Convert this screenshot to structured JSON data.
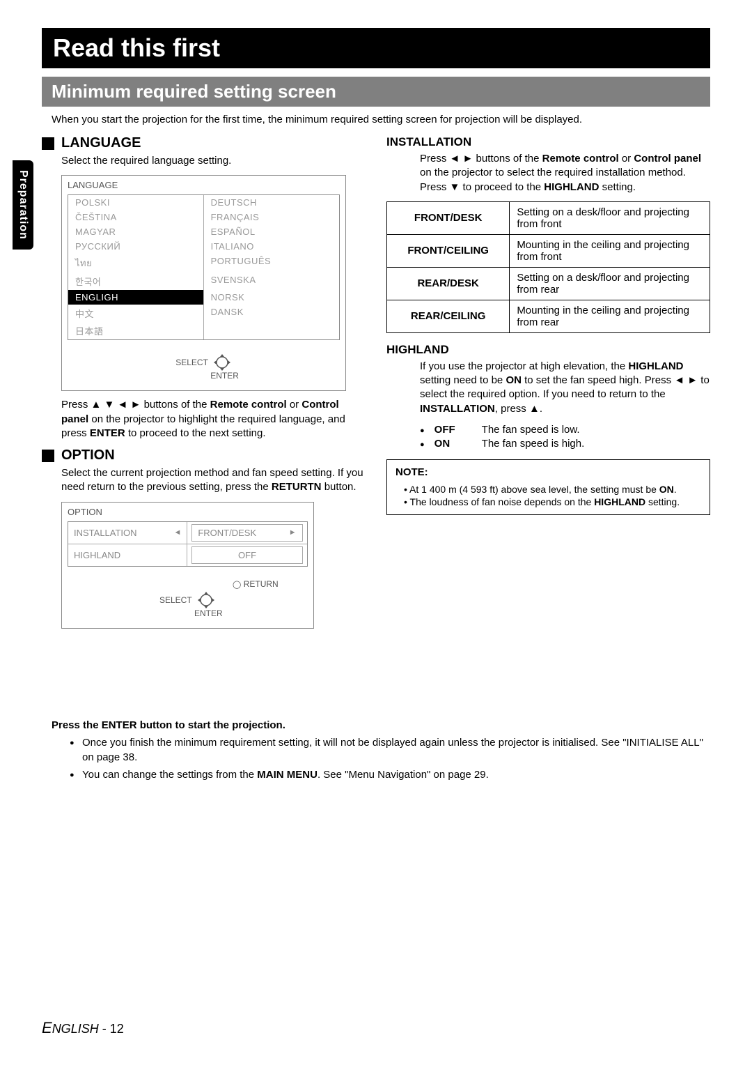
{
  "side_tab": "Preparation",
  "title": "Read this first",
  "section": "Minimum required setting screen",
  "intro": "When you start the projection for the first time, the minimum required setting screen for projection will be displayed.",
  "language": {
    "heading": "LANGUAGE",
    "desc": "Select the required language setting.",
    "menu_title": "LANGUAGE",
    "items_left": [
      "POLSKI",
      "ČEŠTINA",
      "MAGYAR",
      "РУССКИЙ",
      "ไทย",
      "한국어",
      "ENGLIGH",
      "中文",
      "日本語"
    ],
    "items_right": [
      "DEUTSCH",
      "FRANÇAIS",
      "ESPAÑOL",
      "ITALIANO",
      "PORTUGUÊS",
      "SVENSKA",
      "NORSK",
      "DANSK",
      ""
    ],
    "selected": "ENGLIGH",
    "select_label": "SELECT",
    "enter_label": "ENTER",
    "instruction_pre": "Press ",
    "instruction_mid": " buttons of the ",
    "remote": "Remote control",
    "or": " or ",
    "control_panel": "Control panel",
    "instruction_post1": " on the projector to highlight the required language, and press ",
    "enter_bold": "ENTER",
    "instruction_post2": " to proceed to the next setting."
  },
  "option": {
    "heading": "OPTION",
    "desc_pre": "Select the current projection method and fan speed setting. If you need return to the previous setting, press the ",
    "return_bold": "RETURTN",
    "desc_post": " button.",
    "menu_title": "OPTION",
    "rows": [
      {
        "label": "INSTALLATION",
        "value": "FRONT/DESK",
        "arrows": true
      },
      {
        "label": "HIGHLAND",
        "value": "OFF",
        "arrows": false
      }
    ],
    "return_label": "RETURN",
    "select_label": "SELECT",
    "enter_label": "ENTER"
  },
  "installation": {
    "heading": "INSTALLATION",
    "desc_pre": "Press ",
    "desc_mid1": " buttons of the ",
    "remote": "Remote control",
    "or": " or ",
    "control_panel": "Control panel",
    "desc_mid2": " on the projector to select the required installation method. Press ",
    "desc_post": " to proceed to the ",
    "highland_bold": "HIGHLAND",
    "setting_word": " setting.",
    "table": [
      {
        "mode": "FRONT/DESK",
        "desc": "Setting on a desk/floor and projecting from front"
      },
      {
        "mode": "FRONT/CEILING",
        "desc": "Mounting in the ceiling and projecting from front"
      },
      {
        "mode": "REAR/DESK",
        "desc": "Setting on a desk/floor and projecting from rear"
      },
      {
        "mode": "REAR/CEILING",
        "desc": "Mounting in the ceiling and projecting from rear"
      }
    ]
  },
  "highland": {
    "heading": "HIGHLAND",
    "p1a": "If you use the projector at high elevation, the ",
    "p1b": "HIGHLAND",
    "p1c": " setting need to be ",
    "p1d": "ON",
    "p1e": " to set the fan speed high. Press ",
    "p1f": " to select the required option. If you need to return to the ",
    "p1g": "INSTALLATION",
    "p1h": ", press ",
    "p1i": ".",
    "off_label": "OFF",
    "off_desc": "The fan speed is low.",
    "on_label": "ON",
    "on_desc": "The fan speed is high."
  },
  "note": {
    "title": "NOTE:",
    "items": [
      "At 1 400 m (4 593 ft) above sea level, the setting must be ON.",
      "The loudness of fan noise depends on the HIGHLAND setting."
    ],
    "bold1": "ON",
    "bold2": "HIGHLAND"
  },
  "press_enter": "Press the ENTER button to start the projection.",
  "final_bullets": [
    {
      "pre": "Once you finish the minimum requirement setting, it will not be displayed again unless the projector is initialised. See \"INITIALISE ALL\" on page 38."
    },
    {
      "pre": "You can change the settings from the ",
      "bold": "MAIN MENU",
      "post": ". See \"Menu Navigation\" on page 29."
    }
  ],
  "footer": {
    "lang": "ENGLISH",
    "sep": " - ",
    "page": "12"
  }
}
